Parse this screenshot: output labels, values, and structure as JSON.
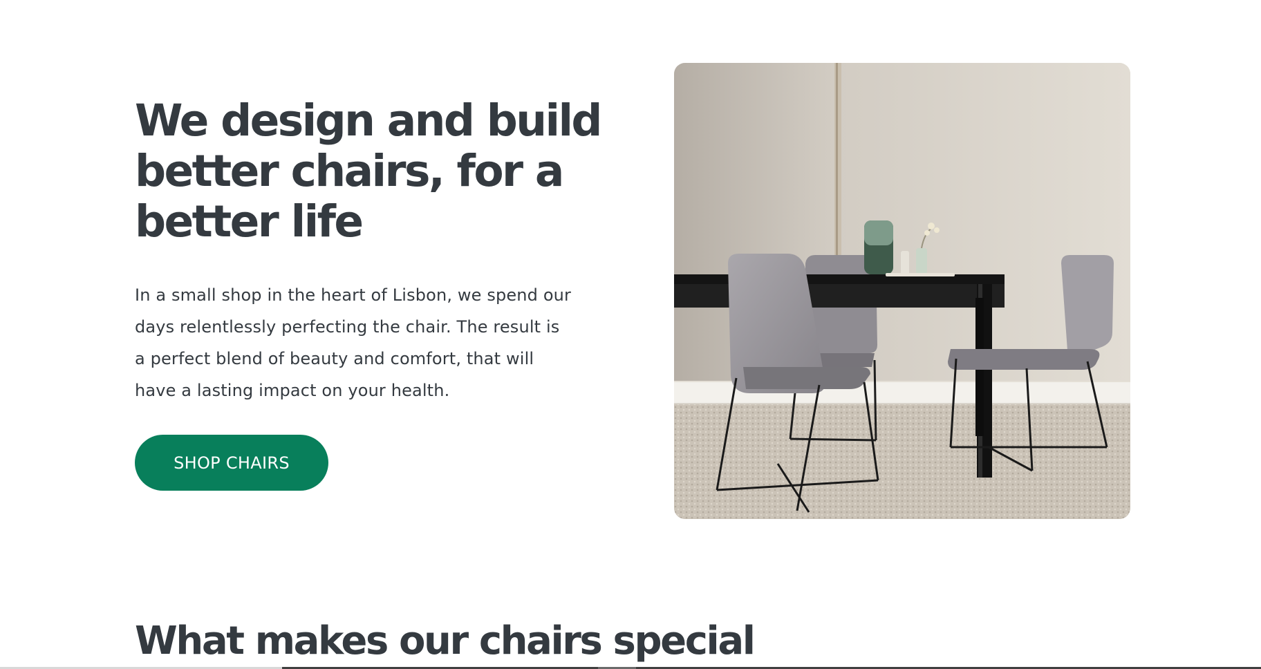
{
  "hero": {
    "title_lines": [
      "We design and build",
      "better chairs, for a",
      "better life"
    ],
    "description_lines": [
      "In a small shop in the heart of Lisbon, we spend our",
      "days relentlessly perfecting the chair. The result is",
      "a perfect blend of beauty and comfort, that will",
      "have a lasting impact on your health."
    ],
    "cta_label": "SHOP CHAIRS",
    "image_alt": "Grey upholstered chairs around a black dining table"
  },
  "features": {
    "title": "What makes our chairs special"
  },
  "colors": {
    "accent": "#087f5b",
    "text": "#343a40",
    "background": "#ffffff"
  }
}
